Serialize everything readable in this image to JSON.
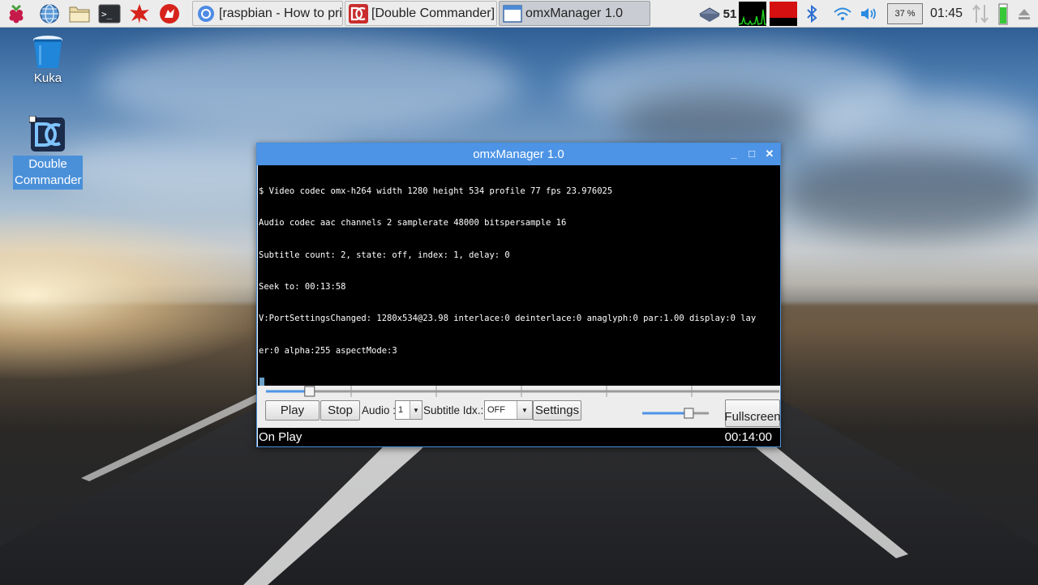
{
  "taskbar": {
    "launchers": [
      {
        "icon": "raspberry-menu-icon"
      },
      {
        "icon": "web-browser-icon"
      },
      {
        "icon": "file-manager-icon"
      },
      {
        "icon": "terminal-icon"
      },
      {
        "icon": "mathematica-icon"
      },
      {
        "icon": "wolfram-icon"
      }
    ],
    "tasks": [
      {
        "label": "[raspbian - How to pri...",
        "icon": "chromium-icon",
        "active": false
      },
      {
        "label": "[Double Commander]",
        "icon": "double-commander-icon",
        "active": false
      },
      {
        "label": "omxManager 1.0",
        "icon": "window-icon",
        "active": true
      }
    ],
    "tray": {
      "cpu_temp": "51",
      "volume_percent": "37 %",
      "clock": "01:45"
    }
  },
  "desktop": {
    "icons": [
      {
        "label": "Kuka",
        "icon": "trash-icon",
        "selected": false
      },
      {
        "label": "Double Commander",
        "label_line1": "Double",
        "label_line2": "Commander",
        "icon": "double-commander-icon",
        "selected": true
      }
    ]
  },
  "window": {
    "title": "omxManager 1.0",
    "controls": {
      "minimize": "_",
      "maximize": "□",
      "close": "✕"
    },
    "terminal_lines": [
      "$ Video codec omx-h264 width 1280 height 534 profile 77 fps 23.976025",
      "Audio codec aac channels 2 samplerate 48000 bitspersample 16",
      "Subtitle count: 2, state: off, index: 1, delay: 0",
      "Seek to: 00:13:58",
      "V:PortSettingsChanged: 1280x534@23.98 interlace:0 deinterlace:0 anaglyph:0 par:1.00 display:0 lay",
      "er:0 alpha:255 aspectMode:3"
    ],
    "seek_fraction": 0.085,
    "volume_fraction": 0.7,
    "controls_row": {
      "play": "Play",
      "stop": "Stop",
      "audio_label": "Audio :",
      "audio_value": "1",
      "subtitle_label": "Subtitle Idx.:",
      "subtitle_value": "OFF",
      "settings": "Settings",
      "fullscreen": "Fullscreen"
    },
    "status": {
      "state": "On Play",
      "time": "00:14:00"
    }
  }
}
